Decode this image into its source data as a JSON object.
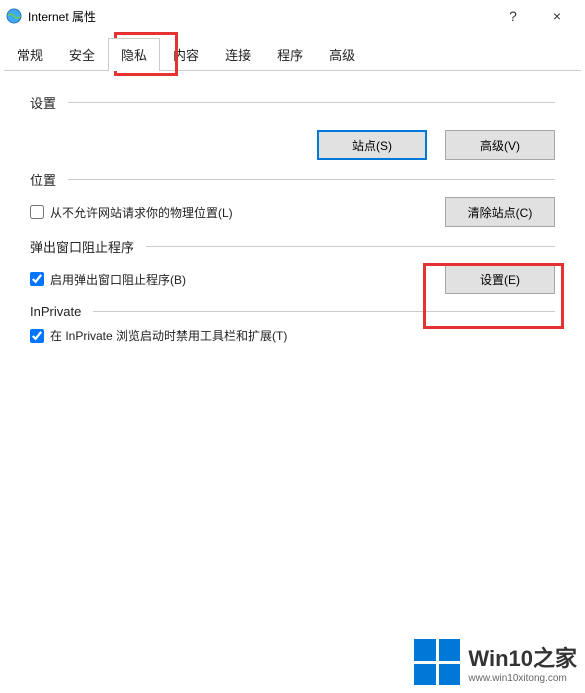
{
  "window": {
    "title": "Internet 属性",
    "help": "?",
    "close": "×"
  },
  "tabs": {
    "general": "常规",
    "security": "安全",
    "privacy": "隐私",
    "content": "内容",
    "connections": "连接",
    "programs": "程序",
    "advanced": "高级"
  },
  "sections": {
    "settings": {
      "title": "设置",
      "sites_btn": "站点(S)",
      "advanced_btn": "高级(V)"
    },
    "location": {
      "title": "位置",
      "checkbox_label": "从不允许网站请求你的物理位置(L)",
      "clear_sites_btn": "清除站点(C)"
    },
    "popup": {
      "title": "弹出窗口阻止程序",
      "checkbox_label": "启用弹出窗口阻止程序(B)",
      "settings_btn": "设置(E)"
    },
    "inprivate": {
      "title": "InPrivate",
      "checkbox_label": "在 InPrivate 浏览启动时禁用工具栏和扩展(T)"
    }
  },
  "watermark": {
    "title": "Win10之家",
    "url": "www.win10xitong.com"
  }
}
